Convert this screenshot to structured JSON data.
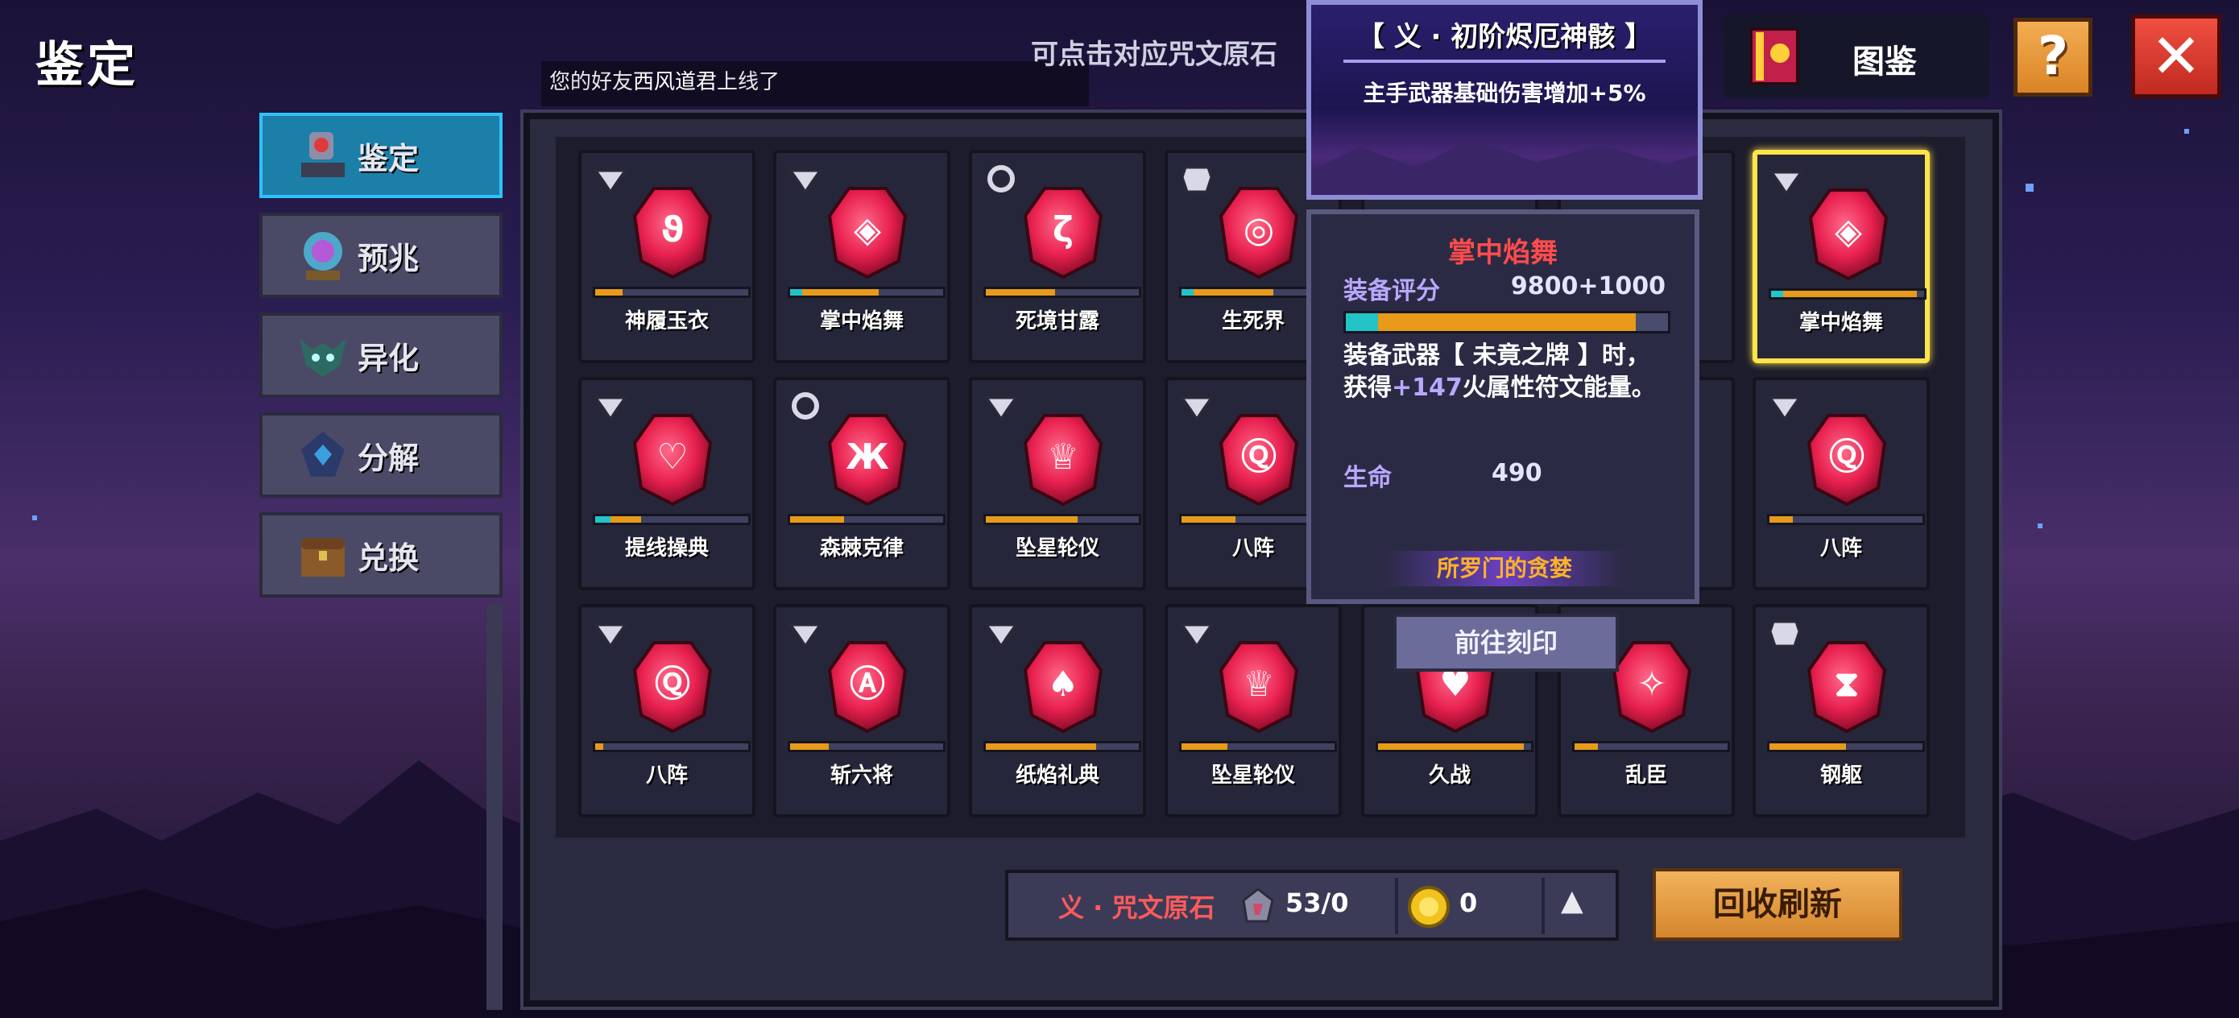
{
  "screen_title": "鉴定",
  "notice": {
    "prefix": "您的好友",
    "name": "西风道君",
    "suffix": "上线了"
  },
  "hint": "可点击对应咒文原石",
  "top_right": {
    "codex_label": "图鉴",
    "help_icon": "question-icon",
    "close_icon": "close-icon"
  },
  "side_tabs": [
    {
      "label": "鉴定",
      "icon": "appraise-icon",
      "active": true
    },
    {
      "label": "预兆",
      "icon": "crystal-ball-icon",
      "active": false
    },
    {
      "label": "异化",
      "icon": "demon-mask-icon",
      "active": false
    },
    {
      "label": "分解",
      "icon": "decompose-gem-icon",
      "active": false
    },
    {
      "label": "兑换",
      "icon": "treasure-chest-icon",
      "active": false
    }
  ],
  "grid": [
    [
      {
        "name": "神履玉衣",
        "badge": "sword-icon",
        "teal": 0,
        "orange": 0.18
      },
      {
        "name": "掌中焰舞",
        "badge": "sword-icon",
        "teal": 0.08,
        "orange": 0.58
      },
      {
        "name": "死境甘露",
        "badge": "ring-icon",
        "teal": 0,
        "orange": 0.45
      },
      {
        "name": "生死界",
        "badge": "armor-icon",
        "teal": 0.08,
        "orange": 0.6
      },
      {
        "name": "",
        "badge": "",
        "teal": 0,
        "orange": 0
      },
      {
        "name": "",
        "badge": "",
        "teal": 0,
        "orange": 0
      },
      {
        "name": "掌中焰舞",
        "badge": "sword-icon",
        "teal": 0.08,
        "orange": 0.95,
        "selected": true
      }
    ],
    [
      {
        "name": "提线操典",
        "badge": "sword-icon",
        "teal": 0.1,
        "orange": 0.3
      },
      {
        "name": "森棘克律",
        "badge": "ring-icon",
        "teal": 0,
        "orange": 0.35
      },
      {
        "name": "坠星轮仪",
        "badge": "sword-icon",
        "teal": 0,
        "orange": 0.6
      },
      {
        "name": "八阵",
        "badge": "sword-icon",
        "teal": 0,
        "orange": 0.35
      },
      {
        "name": "",
        "badge": "",
        "teal": 0,
        "orange": 0
      },
      {
        "name": "",
        "badge": "",
        "teal": 0,
        "orange": 0
      },
      {
        "name": "八阵",
        "badge": "sword-icon",
        "teal": 0,
        "orange": 0.15
      }
    ],
    [
      {
        "name": "八阵",
        "badge": "sword-icon",
        "teal": 0,
        "orange": 0.05
      },
      {
        "name": "斩六将",
        "badge": "sword-icon",
        "teal": 0,
        "orange": 0.25
      },
      {
        "name": "纸焰礼典",
        "badge": "sword-icon",
        "teal": 0,
        "orange": 0.72
      },
      {
        "name": "坠星轮仪",
        "badge": "sword-icon",
        "teal": 0,
        "orange": 0.3
      },
      {
        "name": "久战",
        "badge": "",
        "teal": 0,
        "orange": 0.95
      },
      {
        "name": "乱臣",
        "badge": "",
        "teal": 0,
        "orange": 0.15
      },
      {
        "name": "钢躯",
        "badge": "armor-icon",
        "teal": 0,
        "orange": 0.5
      }
    ]
  ],
  "tooltip_set": {
    "title": "【 义 · 初阶烬厄神骸 】",
    "effect": "主手武器基础伤害增加+5%"
  },
  "tooltip_item": {
    "name": "掌中焰舞",
    "score_label": "装备评分",
    "score_value": "9800+1000",
    "score_fill_teal": 0.1,
    "score_fill_orange": 0.9,
    "desc_line1": "装备武器【 未竟之牌 】时，",
    "desc_line2_prefix": "获得",
    "desc_line2_value": "+147",
    "desc_line2_suffix": "火属性符文能量。",
    "hp_label": "生命",
    "hp_value": "490",
    "set_name": "所罗门的贪婪"
  },
  "goto_button": "前往刻印",
  "bottom_bar": {
    "currency_name": "义 · 咒文原石",
    "stone_count": "53/0",
    "coin_count": "0"
  },
  "refresh_button": "回收刷新",
  "colors": {
    "active_tab": "#1b7fa8",
    "selection": "#ffe34a",
    "gem": "#e8204f",
    "progress": "#e89a1a",
    "teal": "#22c4c8"
  }
}
